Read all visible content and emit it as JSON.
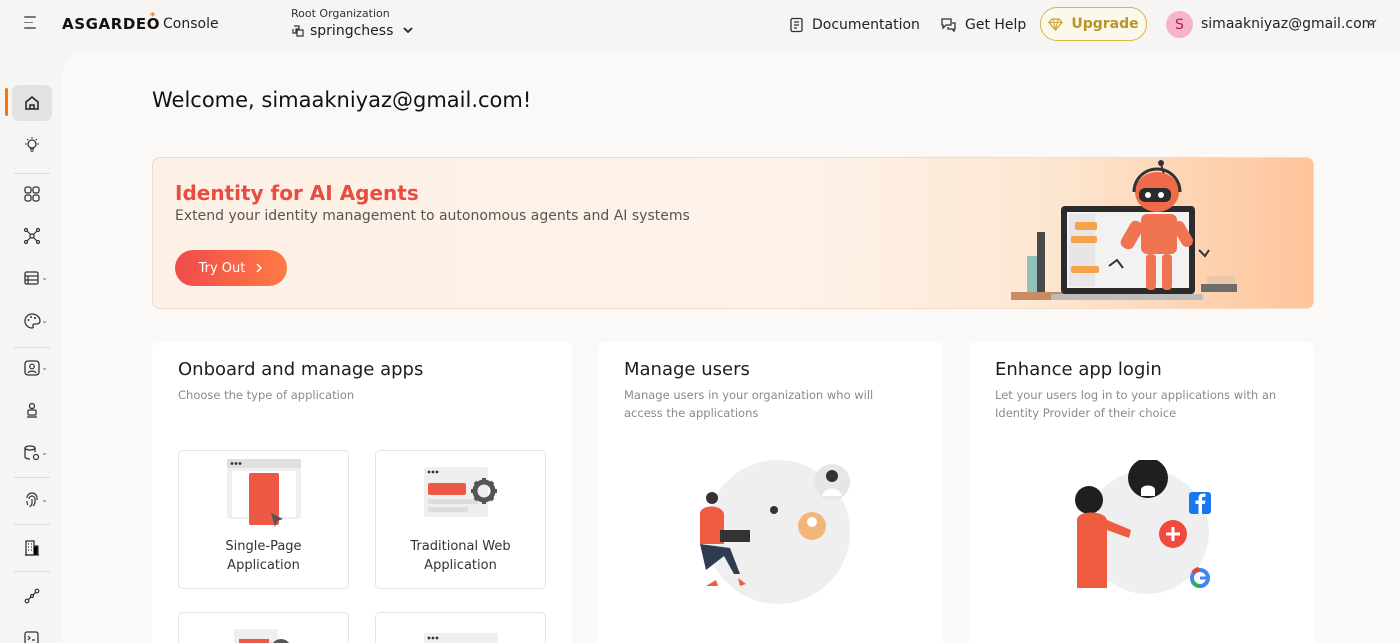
{
  "header": {
    "logo_text": "ASGARDEO",
    "logo_mark": "*",
    "product": "Console",
    "org_label": "Root Organization",
    "org_name": "springchess",
    "documentation": "Documentation",
    "get_help": "Get Help",
    "upgrade": "Upgrade",
    "avatar_initial": "S",
    "user_email": "simaakniyaz@gmail.com"
  },
  "sidebar": {
    "items": [
      {
        "icon": "home-icon",
        "active": true
      },
      {
        "icon": "lightbulb-icon"
      },
      {
        "icon": "applications-grid-icon"
      },
      {
        "icon": "connections-icon"
      },
      {
        "icon": "table-icon",
        "expandable": true
      },
      {
        "icon": "palette-icon",
        "expandable": true
      },
      {
        "icon": "user-card-icon",
        "expandable": true
      },
      {
        "icon": "user-stand-icon"
      },
      {
        "icon": "database-settings-icon",
        "expandable": true
      },
      {
        "icon": "fingerprint-icon",
        "expandable": true
      },
      {
        "icon": "building-icon"
      },
      {
        "icon": "workflow-icon"
      },
      {
        "icon": "logs-icon"
      }
    ]
  },
  "main": {
    "welcome": "Welcome, simaakniyaz@gmail.com!",
    "banner": {
      "title": "Identity for AI Agents",
      "subtitle": "Extend your identity management to autonomous agents and AI systems",
      "button": "Try Out"
    },
    "cards": {
      "apps": {
        "title": "Onboard and manage apps",
        "subtitle": "Choose the type of application",
        "tiles": [
          "Single-Page\nApplication",
          "Traditional Web\nApplication"
        ],
        "spa_line1": "Single-Page",
        "spa_line2": "Application",
        "web_line1": "Traditional Web",
        "web_line2": "Application"
      },
      "users": {
        "title": "Manage users",
        "subtitle_line1": "Manage users in your organization who will",
        "subtitle_line2": "access the applications"
      },
      "login": {
        "title": "Enhance app login",
        "subtitle_line1": "Let your users log in to your applications with an",
        "subtitle_line2": "Identity Provider of their choice"
      }
    }
  },
  "colors": {
    "accent": "#ff7300",
    "banner_title": "#e84d40",
    "upgrade_border": "#d8b547"
  }
}
